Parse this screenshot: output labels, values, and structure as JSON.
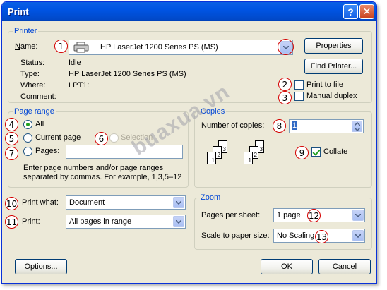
{
  "window": {
    "title": "Print",
    "help_icon": "question-icon",
    "close_icon": "close-icon"
  },
  "printer": {
    "group_label": "Printer",
    "name_label": "Name:",
    "name_value": "HP LaserJet 1200 Series PS (MS)",
    "properties_label": "Properties",
    "find_printer_label": "Find Printer...",
    "status_label": "Status:",
    "status_value": "Idle",
    "type_label": "Type:",
    "type_value": "HP LaserJet 1200 Series PS (MS)",
    "where_label": "Where:",
    "where_value": "LPT1:",
    "comment_label": "Comment:",
    "comment_value": "",
    "print_to_file_label": "Print to file",
    "print_to_file_checked": false,
    "manual_duplex_label": "Manual duplex",
    "manual_duplex_checked": false
  },
  "page_range": {
    "group_label": "Page range",
    "all_label": "All",
    "all_selected": true,
    "current_page_label": "Current page",
    "selection_label": "Selection",
    "pages_label": "Pages:",
    "pages_value": "",
    "hint_line1": "Enter page numbers and/or page ranges",
    "hint_line2": "separated by commas.  For example, 1,3,5–12"
  },
  "print_what": {
    "label": "Print what:",
    "value": "Document"
  },
  "print_scope": {
    "label": "Print:",
    "value": "All pages in range"
  },
  "copies": {
    "group_label": "Copies",
    "number_label": "Number of copies:",
    "number_value": "1",
    "collate_label": "Collate",
    "collate_checked": true,
    "pages_left": [
      "1",
      "2",
      "3"
    ],
    "pages_right": [
      "1",
      "2",
      "3"
    ]
  },
  "zoom": {
    "group_label": "Zoom",
    "pages_per_sheet_label": "Pages per sheet:",
    "pages_per_sheet_value": "1 page",
    "scale_label": "Scale to paper size:",
    "scale_value": "No Scaling"
  },
  "footer": {
    "options_label": "Options...",
    "ok_label": "OK",
    "cancel_label": "Cancel"
  },
  "annotations": [
    "1",
    "2",
    "3",
    "4",
    "5",
    "6",
    "7",
    "8",
    "9",
    "10",
    "11",
    "12",
    "13"
  ],
  "watermark": "buaxua.vn",
  "colors": {
    "annotation_ring": "#d40000",
    "titlebar": "#0054e3",
    "group_label": "#0046d5"
  }
}
